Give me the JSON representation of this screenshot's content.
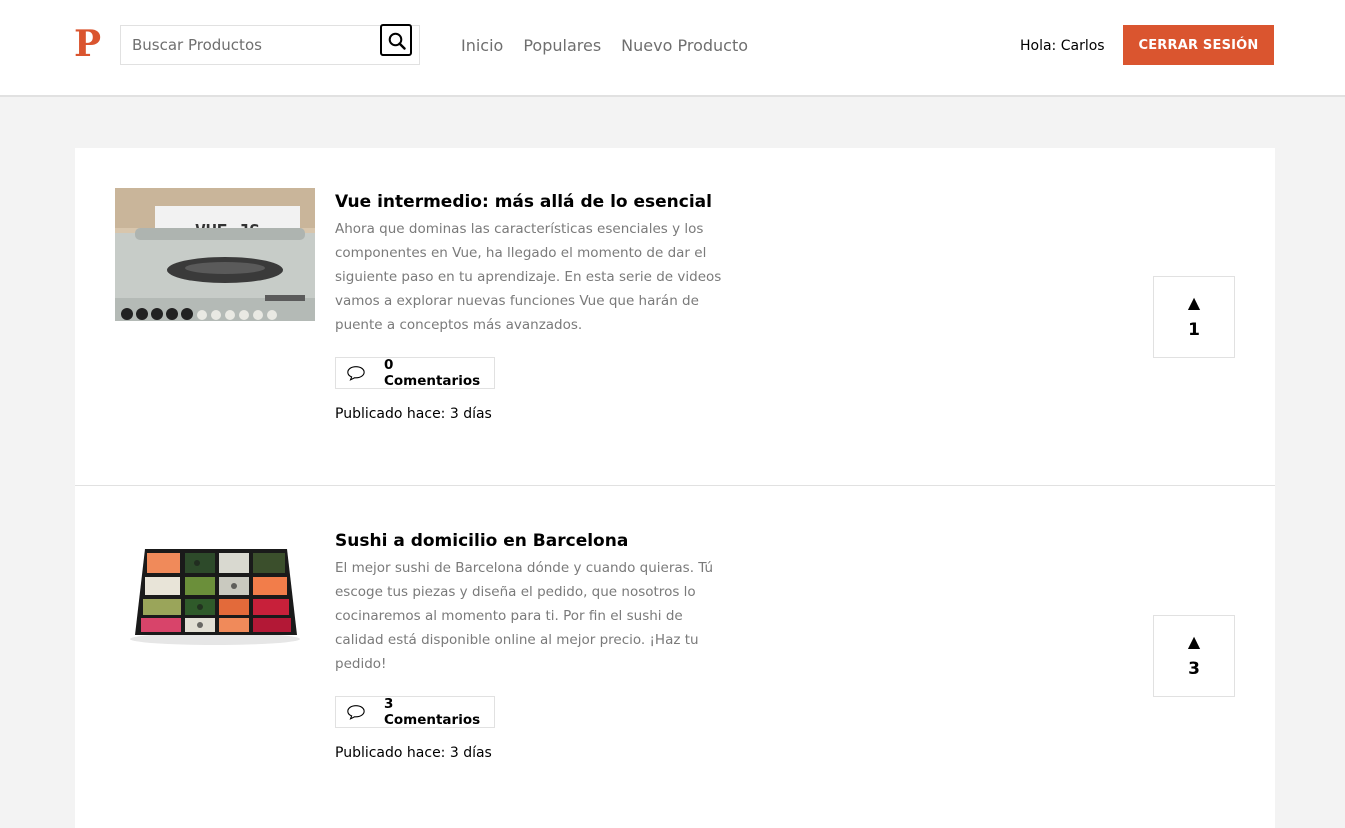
{
  "header": {
    "logo": "P",
    "search_placeholder": "Buscar Productos",
    "nav": [
      "Inicio",
      "Populares",
      "Nuevo Producto"
    ],
    "greeting": "Hola: Carlos",
    "logout_label": "CERRAR SESIÓN"
  },
  "colors": {
    "accent": "#da552f",
    "border": "#e1e1e1",
    "background": "#f3f3f3"
  },
  "products": [
    {
      "title": "Vue intermedio: más allá de lo esencial",
      "description": "Ahora que dominas las características esenciales y los componentes en Vue, ha llegado el momento de dar el siguiente paso en tu aprendizaje. En esta serie de videos vamos a explorar nuevas funciones Vue que harán de puente a conceptos más avanzados.",
      "comments_label": "0 Comentarios",
      "published": "Publicado hace: 3 días",
      "votes": "1",
      "image_text": "VUE.JS"
    },
    {
      "title": "Sushi a domicilio en Barcelona",
      "description": "El mejor sushi de Barcelona dónde y cuando quieras. Tú escoge tus piezas y diseña el pedido, que nosotros lo cocinaremos al momento para ti. Por fin el sushi de calidad está disponible online al mejor precio. ¡Haz tu pedido!",
      "comments_label": "3 Comentarios",
      "published": "Publicado hace: 3 días",
      "votes": "3"
    }
  ]
}
